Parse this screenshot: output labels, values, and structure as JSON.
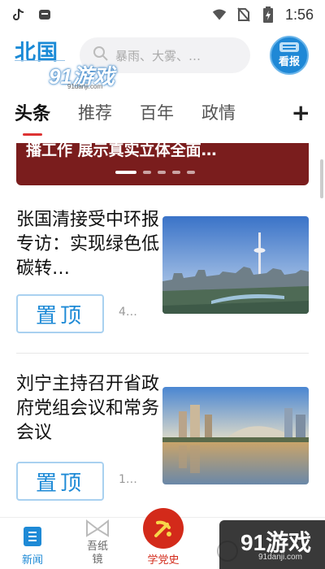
{
  "status_bar": {
    "time": "1:56",
    "icons": [
      "tiktok-icon",
      "app-icon",
      "wifi-icon",
      "sim-off-icon",
      "battery-icon"
    ]
  },
  "header": {
    "logo": "北国",
    "search_placeholder": "暴雨、大雾、…",
    "paper_button_label": "看报"
  },
  "watermark": {
    "text": "91游戏",
    "sub": "91danji.com"
  },
  "tabs": [
    {
      "label": "头条",
      "active": true
    },
    {
      "label": "推荐",
      "active": false
    },
    {
      "label": "百年",
      "active": false
    },
    {
      "label": "政情",
      "active": false
    }
  ],
  "tab_add_label": "+",
  "banner": {
    "title": "播工作 展示真实立体全面…",
    "slide_count": 5,
    "current_slide": 1
  },
  "news": [
    {
      "title": "张国清接受中环报专访：实现绿色低碳转…",
      "pin_label": "置顶",
      "meta": "4…"
    },
    {
      "title": "刘宁主持召开省政府党组会议和常务会议",
      "pin_label": "置顶",
      "meta": "1…"
    }
  ],
  "bottom_nav": [
    {
      "label": "新闻",
      "active": true
    },
    {
      "label": "吾纸镜",
      "active": false
    },
    {
      "label": "学党史",
      "active": false
    }
  ],
  "colors": {
    "accent": "#1e8ad6",
    "tab_indicator": "#dd3333",
    "banner_bg": "#7a1d1d",
    "party_red": "#d32a1a"
  }
}
